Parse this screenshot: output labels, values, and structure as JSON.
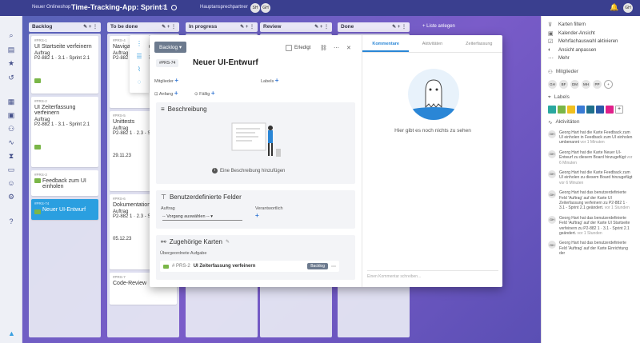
{
  "topbar": {
    "workspace": "Neuer Onlineshop",
    "title": "Time-Tracking-App: Sprint 1",
    "personal": "Hauptansprechpartner",
    "avatars": [
      "SH",
      "GH"
    ],
    "user_avatar": "GH"
  },
  "columns": [
    {
      "name": "Backlog",
      "cards": [
        {
          "id": "#PRS-1",
          "title": "UI Startseite verfeinern",
          "field": "Auftrag",
          "sub": "P2-882 1 · 3.1 - Sprint 2.1",
          "label_color": "#7ab648"
        },
        {
          "id": "#PRS-2",
          "title": "UI Zeiterfassung verfeinern",
          "field": "Auftrag",
          "sub": "P2-882 1 · 3.1 - Sprint 2.1",
          "label_color": "#7ab648"
        },
        {
          "id": "#PRS-3",
          "title": "Feedback zum UI einholen",
          "field": "",
          "sub": "",
          "label_color": "#7ab648"
        },
        {
          "id": "#PRS-74",
          "title": "Neuer UI-Entwurf",
          "field": "",
          "sub": "",
          "label_color": "#7ab648",
          "active": true
        }
      ]
    },
    {
      "name": "To be done",
      "cards": [
        {
          "id": "#PRS-4",
          "title": "Navigation implem...",
          "field": "Auftrag",
          "sub": "P2-882 1 · 2.3 - Sprint 1.3",
          "label_color": "#7ab648"
        },
        {
          "id": "#PRS-5",
          "title": "Unittests",
          "field": "Auftrag",
          "sub": "P2-882 1 · 2.3 - Sprint 1.3",
          "label_color": "#7ab648",
          "date": "29.11.23"
        },
        {
          "id": "#PRS-6",
          "title": "Dokumentation",
          "field": "Auftrag",
          "sub": "P2-882 1 · 2.3 - Sprint 1.3",
          "label_color": "#7ab648",
          "date": "05.12.23"
        },
        {
          "id": "#PRS-7",
          "title": "Code-Review",
          "field": "",
          "sub": "",
          "label_color": "#7ab648"
        }
      ]
    },
    {
      "name": "In progress",
      "cards": []
    },
    {
      "name": "Review",
      "cards": []
    },
    {
      "name": "Done",
      "cards": []
    }
  ],
  "add_list": "+ Liste anlegen",
  "modal": {
    "column_select": "Backlog",
    "done_label": "Erledigt",
    "card_id": "#PRS-74",
    "card_title": "Neuer UI-Entwurf",
    "members_label": "Mitglieder",
    "labels_label": "Labels",
    "start_label": "Anfang",
    "due_label": "Fällig",
    "description_title": "Beschreibung",
    "add_description": "Eine Beschreibung hinzufügen",
    "custom_fields_title": "Benutzerdefinierte Felder",
    "order_label": "Auftrag",
    "order_placeholder": "-- Vorgang auswählen --",
    "responsible_label": "Verantwortlich",
    "related_title": "Zugehörige Karten",
    "parent_label": "Übergeordnete Aufgabe",
    "related_card_id": "# PRS-2",
    "related_card_title": "UI Zeiterfassung verfeinern",
    "related_card_status": "Backlog",
    "tabs": [
      "Kommentare",
      "Aktivitäten",
      "Zeiterfassung"
    ],
    "empty_text": "Hier gibt es noch nichts zu sehen",
    "comment_placeholder": "Einen Kommentar schreiben..."
  },
  "rightpanel": {
    "items": [
      "Karten filtern",
      "Kalender-Ansicht",
      "Mehrfachauswahl aktivieren",
      "Ansicht anpassen",
      "Mehr"
    ],
    "members_title": "Mitglieder",
    "members": [
      "GH",
      "BF",
      "DM",
      "MH",
      "PP"
    ],
    "labels_title": "Labels",
    "label_colors": [
      "#2aa8a0",
      "#7ab648",
      "#f0c020",
      "#3a7bd5",
      "#1f6f8b",
      "#2a5aa8",
      "#e0208a"
    ],
    "activity_title": "Aktivitäten",
    "activities": [
      {
        "text": "Georg Hart hat die Karte Feedback zum UI einholen in Feedback zum UI einholen umbenannt",
        "time": "vor 1 Minuten"
      },
      {
        "text": "Georg Hart hat die Karte Neuer UI-Entwurf zu diesem Board hinzugefügt",
        "time": "vor 6 Minuten"
      },
      {
        "text": "Georg Hart hat die Karte Feedback zum UI einholen zu diesem Board hinzugefügt",
        "time": "vor 6 Minuten"
      },
      {
        "text": "Georg Hart hat das benutzerdefinierte Feld 'Auftrag' auf der Karte UI Zeiterfassung verfeinern zu P2-882 1 · 3.1 - Sprint 2.1 geändert.",
        "time": "vor 1 Stunden"
      },
      {
        "text": "Georg Hart hat das benutzerdefinierte Feld 'Auftrag' auf der Karte UI Startseite verfeinern zu P2-882 1 · 3.1 - Sprint 2.1 geändert.",
        "time": "vor 1 Stunden"
      },
      {
        "text": "Georg Hart hat das benutzerdefinierte Feld 'Auftrag' auf der Karte Einrichtung der",
        "time": ""
      }
    ]
  }
}
